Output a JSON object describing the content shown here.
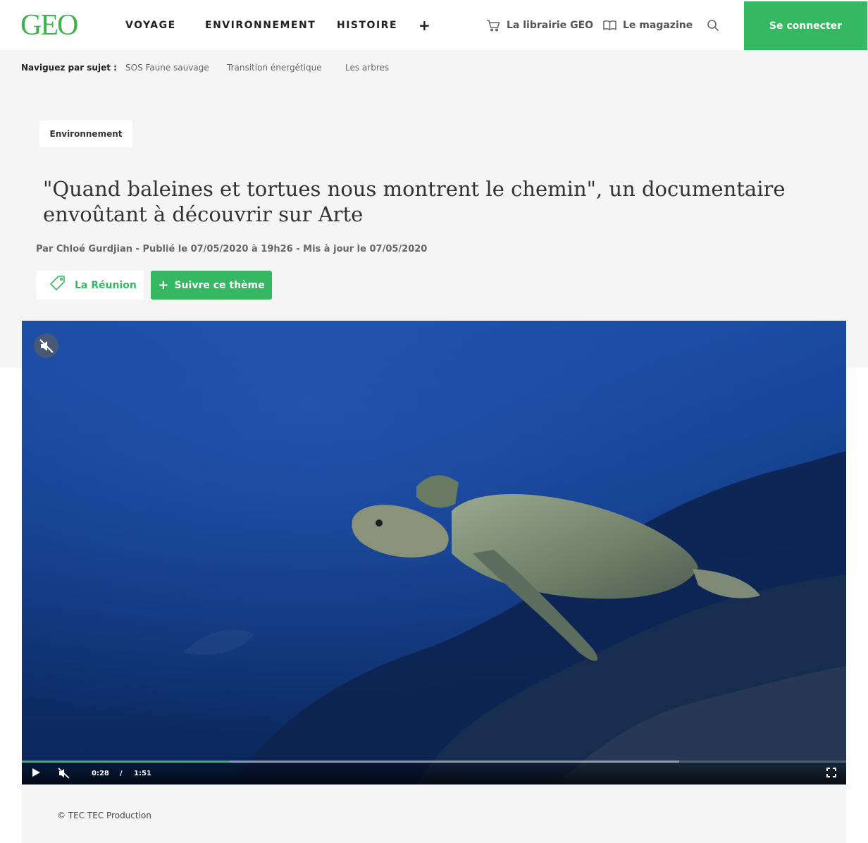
{
  "header": {
    "logo": "GEO",
    "nav": [
      "VOYAGE",
      "ENVIRONNEMENT",
      "HISTOIRE"
    ],
    "nav_more": "+",
    "shop": "La librairie GEO",
    "magazine": "Le magazine",
    "login": "Se connecter"
  },
  "subjects": {
    "label": "Naviguez par sujet :",
    "items": [
      "SOS Faune sauvage",
      "Transition énergétique",
      "Les arbres"
    ]
  },
  "article": {
    "category": "Environnement",
    "title": "\"Quand baleines et tortues nous montrent le chemin\", un documentaire envoûtant à découvrir sur Arte",
    "byline": "Par Chloé Gurdjian - Publié le 07/05/2020 à 19h26 - Mis à jour le 07/05/2020",
    "tag": "La Réunion",
    "follow": "Suivre ce thème"
  },
  "video": {
    "current_time": "0:28",
    "separator": "/",
    "duration": "1:51",
    "progress": 0.2513,
    "buffered": 0.7974,
    "muted": true,
    "caption": "© TEC TEC Production"
  },
  "colors": {
    "brand_green": "#36b862",
    "background_grey": "#f5f5f5",
    "ocean_blue": "#0b2a63"
  }
}
